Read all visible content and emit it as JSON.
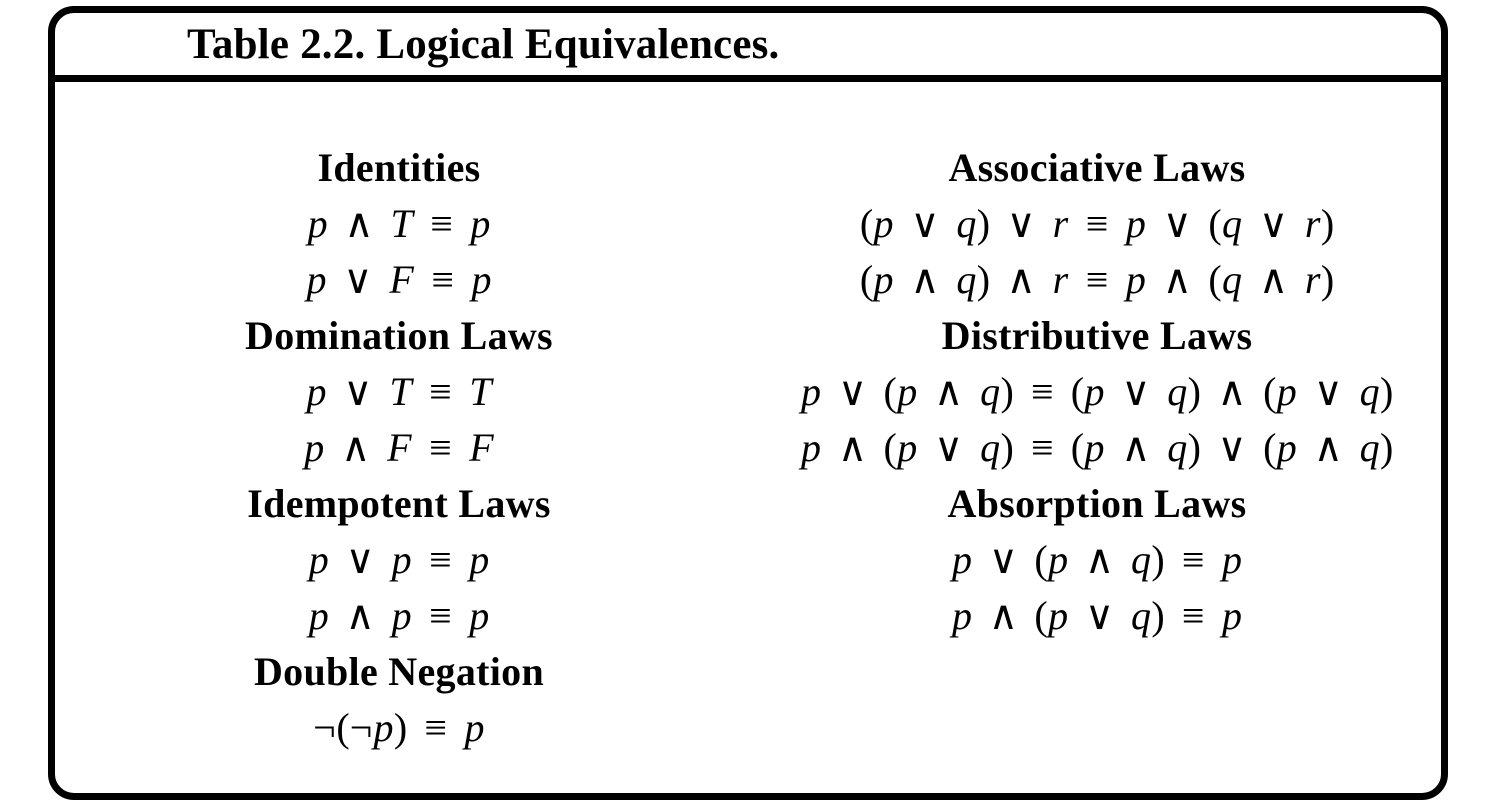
{
  "caption": {
    "label": "Table",
    "number": "2.2",
    "separator": ". ",
    "title": "Logical Equivalences.",
    "full": "Table 2.2. Logical Equivalences."
  },
  "symbols": {
    "and": "∧",
    "or": "∨",
    "equiv": "≡",
    "not": "¬",
    "lparen": "(",
    "rparen": ")"
  },
  "columns": {
    "left": {
      "groups": [
        {
          "heading": "Identities",
          "formulas": [
            "p ∧ T ≡ p",
            "p ∨ F ≡ p"
          ]
        },
        {
          "heading": "Domination Laws",
          "formulas": [
            "p ∨ T ≡ T",
            "p ∧ F ≡ F"
          ]
        },
        {
          "heading": "Idempotent Laws",
          "formulas": [
            "p ∨ p ≡ p",
            "p ∧ p ≡ p"
          ]
        },
        {
          "heading": "Double Negation",
          "formulas": [
            "¬(¬p) ≡ p"
          ]
        }
      ]
    },
    "right": {
      "groups": [
        {
          "heading": "Associative Laws",
          "formulas": [
            "(p ∨ q) ∨ r ≡ p ∨ (q ∨ r)",
            "(p ∧ q) ∧ r ≡ p ∧ (q ∧ r)"
          ]
        },
        {
          "heading": "Distributive Laws",
          "formulas": [
            "p ∨ (p ∧ q) ≡ (p ∨ q) ∧ (p ∨ q)",
            "p ∧ (p ∨ q) ≡ (p ∧ q) ∨ (p ∧ q)"
          ]
        },
        {
          "heading": "Absorption Laws",
          "formulas": [
            "p ∨ (p ∧ q) ≡ p",
            "p ∧ (p ∨ q) ≡ p"
          ]
        }
      ]
    }
  }
}
